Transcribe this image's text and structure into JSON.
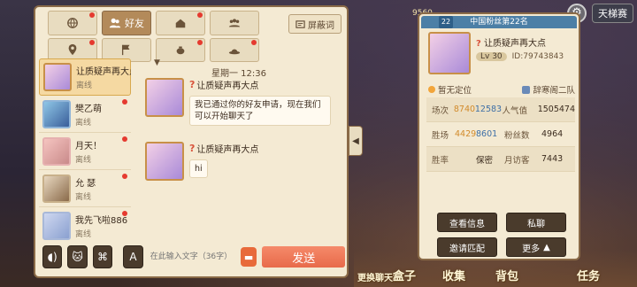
{
  "tabs": [
    {
      "label": "",
      "icon": "globe-icon",
      "dot": true
    },
    {
      "label": "好友",
      "icon": "friends-icon",
      "dot": false,
      "active": true
    },
    {
      "label": "",
      "icon": "house-icon",
      "dot": true
    },
    {
      "label": "",
      "icon": "group-icon",
      "dot": false
    },
    {
      "label": "",
      "icon": "location-icon",
      "dot": true
    },
    {
      "label": "",
      "icon": "flag-icon",
      "dot": false
    },
    {
      "label": "",
      "icon": "teapot-icon",
      "dot": true
    },
    {
      "label": "",
      "icon": "hat-icon",
      "dot": true
    }
  ],
  "shield": {
    "label": "屏蔽词"
  },
  "friends": [
    {
      "name": "让质疑声再大点",
      "status": "离线",
      "active": true,
      "dot": false
    },
    {
      "name": "樊乙萌",
      "status": "离线",
      "active": false,
      "dot": true
    },
    {
      "name": "月天！",
      "status": "离线",
      "active": false,
      "dot": true
    },
    {
      "name": "允  瑟",
      "status": "离线",
      "active": false,
      "dot": true
    },
    {
      "name": "我先飞啦886",
      "status": "离线",
      "active": false,
      "dot": true
    }
  ],
  "chat": {
    "date": "星期一   12:36",
    "messages": [
      {
        "sender": "让质疑声再大点",
        "text": "我已通过你的好友申请，现在我们可以开始聊天了"
      },
      {
        "sender": "让质疑声再大点",
        "text": "hi"
      }
    ]
  },
  "input": {
    "placeholder": "在此输入文字（36字）",
    "send_label": "发送"
  },
  "profile": {
    "rank_badge": "22",
    "rank_title": "中国粉丝第22名",
    "name": "让质疑声再大点",
    "level": "Lv 30",
    "id": "ID:79743843",
    "location": "暂无定位",
    "team": "辞寒阁二队",
    "stats": [
      {
        "k1": "场次",
        "v1": "8740",
        "v2": "12583",
        "k2": "人气值",
        "v3": "1505474"
      },
      {
        "k1": "胜场",
        "v1": "4429",
        "v2": "8601",
        "k2": "粉丝数",
        "v3": "4964"
      },
      {
        "k1": "胜率",
        "v1": "",
        "v2": "保密",
        "k2": "月访客",
        "v3": "7443"
      }
    ],
    "buttons": {
      "view": "查看信息",
      "chat": "私聊",
      "invite": "邀请匹配",
      "more": "更多"
    }
  },
  "scene": {
    "coin": "9560",
    "ladder": "天梯赛",
    "bottom_labels": [
      "更换聊天框",
      "盒子",
      "收集",
      "背包",
      "任务"
    ]
  }
}
